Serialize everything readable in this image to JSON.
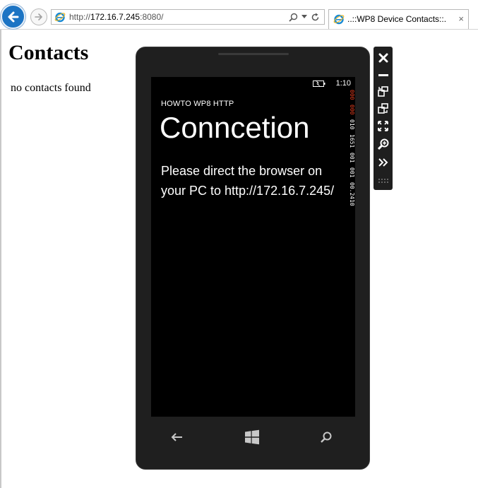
{
  "browser": {
    "url_scheme": "http://",
    "url_host": "172.16.7.245",
    "url_port": ":8080/",
    "tab_title": "..::WP8 Device Contacts::...",
    "tab_close": "×"
  },
  "page": {
    "heading": "Contacts",
    "empty_message": "no contacts found"
  },
  "phone": {
    "status_time": "1:10",
    "app_subtitle": "HOWTO WP8 HTTP",
    "app_title": "Conncetion",
    "message": "Please direct the browser on your PC to http://172.16.7.245/",
    "frame_counters": [
      {
        "text": "000",
        "color": "#e03c1e"
      },
      {
        "text": "000",
        "color": "#e03c1e"
      },
      {
        "text": "010",
        "color": "#ffffff"
      },
      {
        "text": "1651",
        "color": "#ffffff"
      },
      {
        "text": "001",
        "color": "#ffffff"
      },
      {
        "text": "001",
        "color": "#ffffff"
      },
      {
        "text": "00.2410",
        "color": "#ffffff"
      }
    ],
    "hardware_buttons": [
      "back-icon",
      "windows-start-icon",
      "search-icon"
    ]
  },
  "toolbar": {
    "buttons": [
      "close-icon",
      "minimize-icon",
      "rotate-left-icon",
      "rotate-right-icon",
      "fit-to-screen-icon",
      "zoom-icon",
      "more-tools-icon"
    ]
  },
  "colors": {
    "ie_blue": "#1c74c4",
    "phone_frame": "#1f1f1f",
    "counter_red": "#e03c1e"
  }
}
